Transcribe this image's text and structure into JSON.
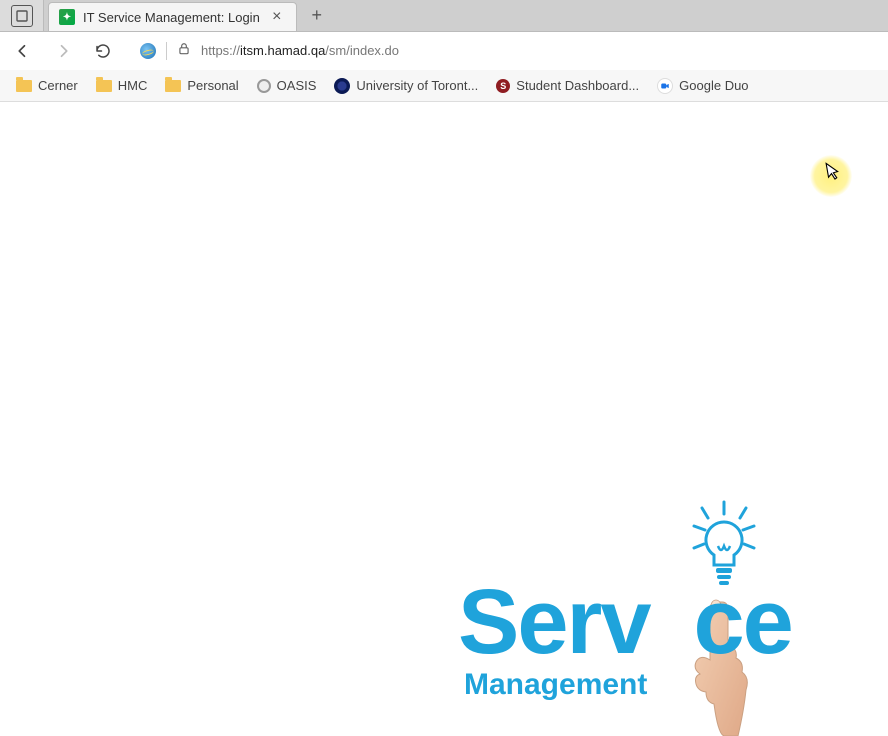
{
  "tab": {
    "title": "IT Service Management: Login"
  },
  "address": {
    "scheme": "https://",
    "host": "itsm.hamad.qa",
    "path": "/sm/index.do"
  },
  "bookmarks": [
    {
      "label": "Cerner",
      "icon": "folder"
    },
    {
      "label": "HMC",
      "icon": "folder"
    },
    {
      "label": "Personal",
      "icon": "folder"
    },
    {
      "label": "OASIS",
      "icon": "oasis"
    },
    {
      "label": "University of Toront...",
      "icon": "uoft"
    },
    {
      "label": "Student Dashboard...",
      "icon": "sd"
    },
    {
      "label": "Google Duo",
      "icon": "duo"
    }
  ],
  "logo": {
    "line1_a": "Serv",
    "line1_b": "ce",
    "line2": "Management"
  }
}
